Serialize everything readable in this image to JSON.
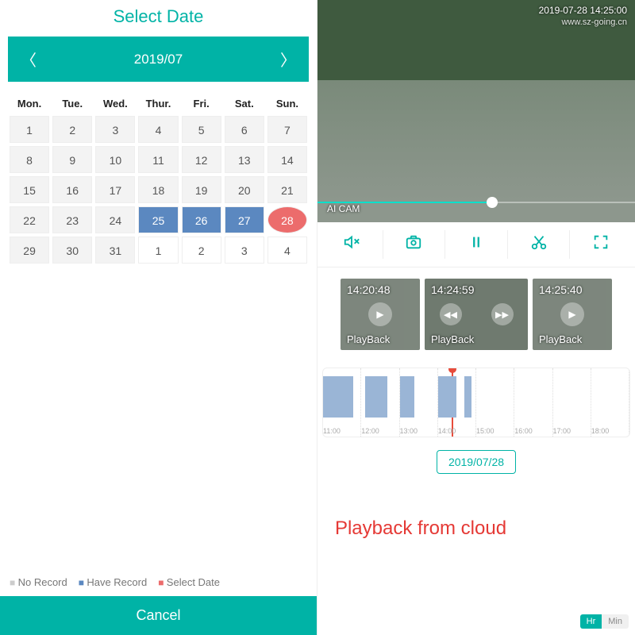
{
  "calendar": {
    "title": "Select Date",
    "month_label": "2019/07",
    "weekdays": [
      "Mon.",
      "Tue.",
      "Wed.",
      "Thur.",
      "Fri.",
      "Sat.",
      "Sun."
    ],
    "weeks": [
      [
        {
          "d": "1",
          "c": "gray"
        },
        {
          "d": "2",
          "c": "gray"
        },
        {
          "d": "3",
          "c": "gray"
        },
        {
          "d": "4",
          "c": "gray"
        },
        {
          "d": "5",
          "c": "gray"
        },
        {
          "d": "6",
          "c": "gray"
        },
        {
          "d": "7",
          "c": "gray"
        }
      ],
      [
        {
          "d": "8",
          "c": "gray"
        },
        {
          "d": "9",
          "c": "gray"
        },
        {
          "d": "10",
          "c": "gray"
        },
        {
          "d": "11",
          "c": "gray"
        },
        {
          "d": "12",
          "c": "gray"
        },
        {
          "d": "13",
          "c": "gray"
        },
        {
          "d": "14",
          "c": "gray"
        }
      ],
      [
        {
          "d": "15",
          "c": "gray"
        },
        {
          "d": "16",
          "c": "gray"
        },
        {
          "d": "17",
          "c": "gray"
        },
        {
          "d": "18",
          "c": "gray"
        },
        {
          "d": "19",
          "c": "gray"
        },
        {
          "d": "20",
          "c": "gray"
        },
        {
          "d": "21",
          "c": "gray"
        }
      ],
      [
        {
          "d": "22",
          "c": "gray"
        },
        {
          "d": "23",
          "c": "gray"
        },
        {
          "d": "24",
          "c": "gray"
        },
        {
          "d": "25",
          "c": "have"
        },
        {
          "d": "26",
          "c": "have"
        },
        {
          "d": "27",
          "c": "have"
        },
        {
          "d": "28",
          "c": "sel"
        }
      ],
      [
        {
          "d": "29",
          "c": "gray"
        },
        {
          "d": "30",
          "c": "gray"
        },
        {
          "d": "31",
          "c": "gray"
        },
        {
          "d": "1",
          "c": ""
        },
        {
          "d": "2",
          "c": ""
        },
        {
          "d": "3",
          "c": ""
        },
        {
          "d": "4",
          "c": ""
        }
      ]
    ],
    "legend": {
      "no_record": "No Record",
      "have_record": "Have Record",
      "select_date": "Select Date"
    },
    "cancel": "Cancel"
  },
  "player": {
    "timestamp": "2019-07-28 14:25:00",
    "site": "www.sz-going.cn",
    "ai_label": "AI CAM",
    "date_chip": "2019/07/28",
    "caption": "Playback from cloud",
    "hr": "Hr",
    "min": "Min"
  },
  "clips": [
    {
      "time": "14:20:48",
      "label": "PlayBack"
    },
    {
      "time": "14:24:59",
      "label": "PlayBack"
    },
    {
      "time": "14:25:40",
      "label": "PlayBack"
    }
  ],
  "timeline": {
    "ticks": [
      "11:00",
      "12:00",
      "13:00",
      "14:00",
      "15:00",
      "16:00",
      "17:00",
      "18:00"
    ],
    "segments": [
      {
        "col": 0,
        "left": "0%",
        "width": "80%"
      },
      {
        "col": 1,
        "left": "10%",
        "width": "60%"
      },
      {
        "col": 2,
        "left": "0%",
        "width": "40%"
      },
      {
        "col": 3,
        "left": "0%",
        "width": "50%"
      },
      {
        "col": 3,
        "left": "70%",
        "width": "20%"
      }
    ]
  }
}
